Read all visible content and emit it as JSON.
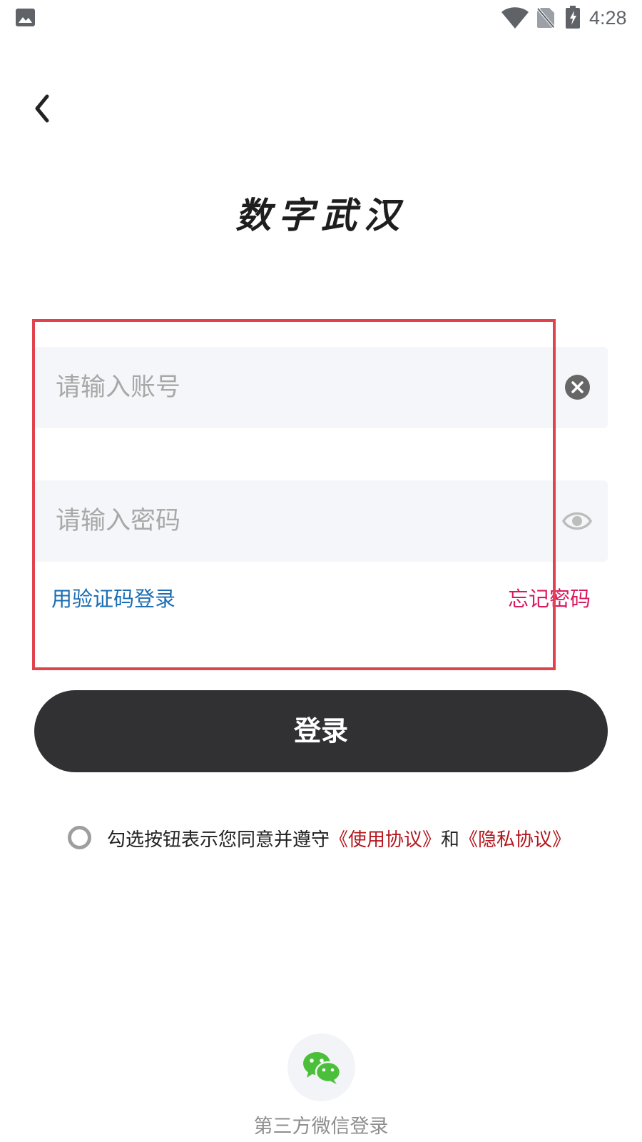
{
  "status_bar": {
    "time": "4:28",
    "icons": [
      "photo-icon",
      "wifi-icon",
      "no-sim-icon",
      "battery-charging-icon"
    ]
  },
  "header": {
    "back_icon": "chevron-left-icon"
  },
  "brand": {
    "title": "数字武汉"
  },
  "account_field": {
    "placeholder": "请输入账号",
    "value": "",
    "action_icon": "clear-icon"
  },
  "password_field": {
    "placeholder": "请输入密码",
    "value": "",
    "action_icon": "eye-icon"
  },
  "links": {
    "sms_login": "用验证码登录",
    "forgot_password": "忘记密码"
  },
  "login_button": {
    "label": "登录"
  },
  "agreement": {
    "prefix": "勾选按钮表示您同意并遵守",
    "terms": "《使用协议》",
    "conjunction": "和",
    "privacy": "《隐私协议》",
    "checked": false
  },
  "third_party": {
    "icon": "wechat-icon",
    "label": "第三方微信登录"
  },
  "colors": {
    "highlight_border": "#e0434b",
    "link_blue": "#1b6db3",
    "forgot_pink": "#d81b60",
    "agreement_link": "#b3161c",
    "button_dark": "#313134",
    "field_bg": "#f5f6f9",
    "wechat_green": "#4bbf3a"
  }
}
